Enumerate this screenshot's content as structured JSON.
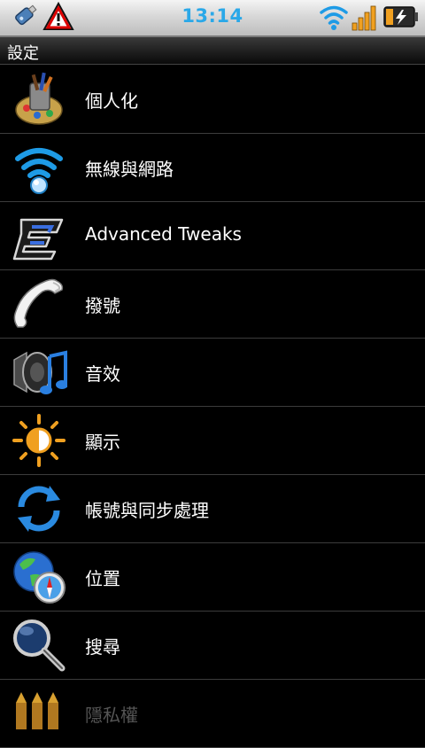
{
  "status_bar": {
    "time": "13:14",
    "icons": [
      "usb-icon",
      "warning-icon",
      "wifi-icon",
      "signal-icon",
      "battery-charging-icon"
    ]
  },
  "header": {
    "title": "設定"
  },
  "settings": {
    "items": [
      {
        "label": "個人化",
        "icon": "personalize-icon"
      },
      {
        "label": "無線與網路",
        "icon": "wireless-icon"
      },
      {
        "label": "Advanced Tweaks",
        "icon": "tweaks-icon"
      },
      {
        "label": "撥號",
        "icon": "phone-icon"
      },
      {
        "label": "音效",
        "icon": "sound-icon"
      },
      {
        "label": "顯示",
        "icon": "display-icon"
      },
      {
        "label": "帳號與同步處理",
        "icon": "sync-icon"
      },
      {
        "label": "位置",
        "icon": "location-icon"
      },
      {
        "label": "搜尋",
        "icon": "search-icon"
      },
      {
        "label": "隱私權",
        "icon": "privacy-icon"
      }
    ]
  },
  "colors": {
    "clock": "#2aa8e8",
    "background": "#000000",
    "divider": "#3c3c3c"
  }
}
